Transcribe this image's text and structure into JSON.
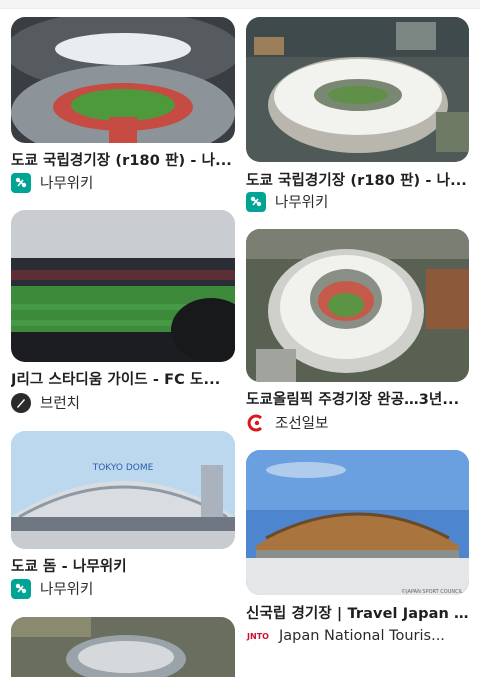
{
  "results": [
    {
      "title": "도쿄 국립경기장 (r180 판) - 나...",
      "source": "나무위키",
      "favicon": "namuwiki-icon"
    },
    {
      "title": "도쿄 국립경기장 (r180 판) - 나...",
      "source": "나무위키",
      "favicon": "namuwiki-icon"
    },
    {
      "title": "J리그 스타디움 가이드 - FC 도...",
      "source": "브런치",
      "favicon": "brunch-icon"
    },
    {
      "title": "도쿄올림픽 주경기장 완공…3년...",
      "source": "조선일보",
      "favicon": "chosun-icon"
    },
    {
      "title": "도쿄 돔 - 나무위키",
      "source": "나무위키",
      "favicon": "namuwiki-icon",
      "image_text": "TOKYO DOME"
    },
    {
      "title": "신국립 경기장 | Travel Japan ...",
      "source": "Japan National Touris...",
      "favicon": "jnto-icon",
      "favicon_text": "JNTO",
      "image_credit": "©JAPAN SPORT COUNCIL"
    },
    {
      "title": "",
      "source": "",
      "favicon": ""
    }
  ],
  "colors": {
    "namuwiki": "#00a495",
    "brunch": "#2b2b2b",
    "chosun": "#d71920",
    "jnto": "#c8102e"
  }
}
